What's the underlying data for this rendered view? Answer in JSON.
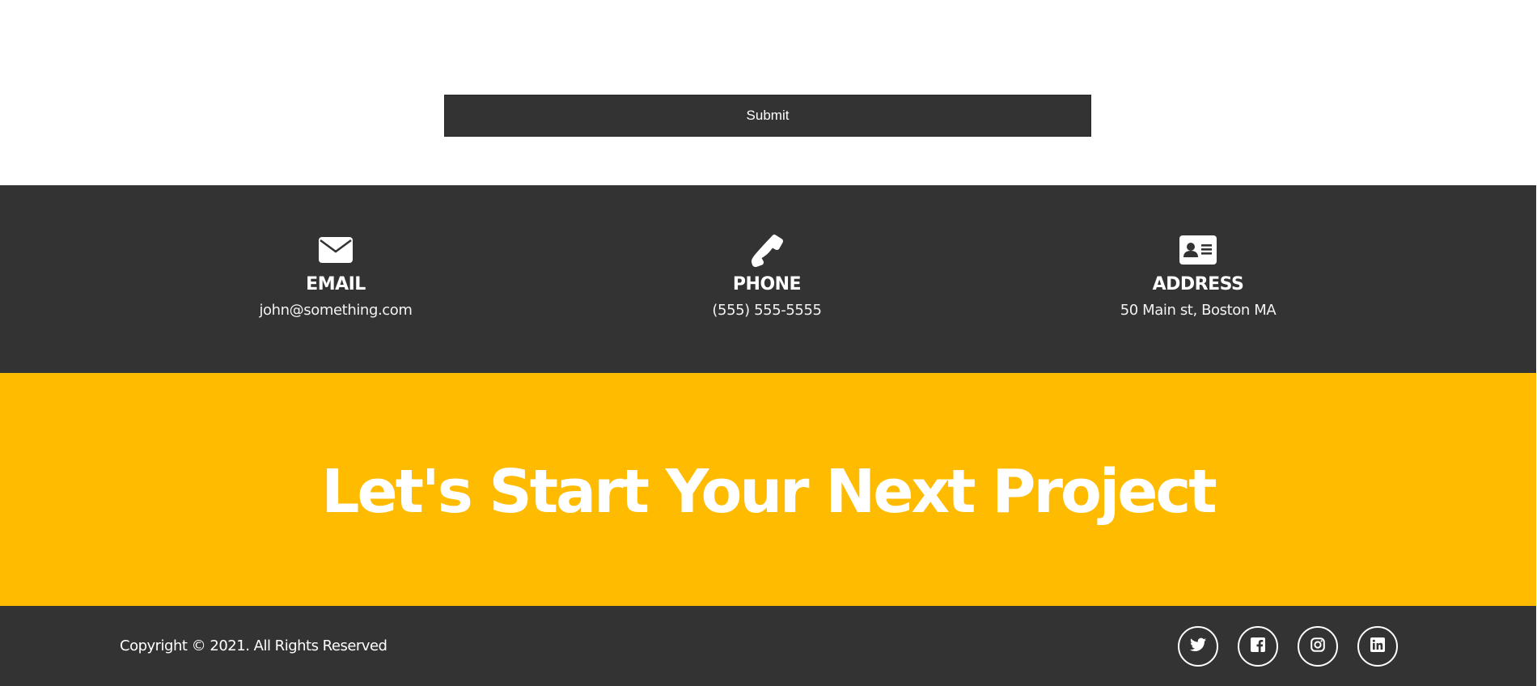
{
  "form": {
    "submit_label": "Submit"
  },
  "contact": {
    "email": {
      "icon": "envelope-icon",
      "title": "EMAIL",
      "value": "john@something.com"
    },
    "phone": {
      "icon": "phone-icon",
      "title": "PHONE",
      "value": "(555) 555-5555"
    },
    "address": {
      "icon": "address-card-icon",
      "title": "ADDRESS",
      "value": "50 Main st, Boston MA"
    }
  },
  "cta": {
    "heading": "Let's Start Your Next Project"
  },
  "footer": {
    "copyright": "Copyright © 2021. All Rights Reserved",
    "social": [
      {
        "icon": "twitter-icon"
      },
      {
        "icon": "facebook-icon"
      },
      {
        "icon": "instagram-icon"
      },
      {
        "icon": "linkedin-icon"
      }
    ]
  },
  "colors": {
    "dark": "#333333",
    "accent": "#ffbb00",
    "light": "#ffffff"
  }
}
